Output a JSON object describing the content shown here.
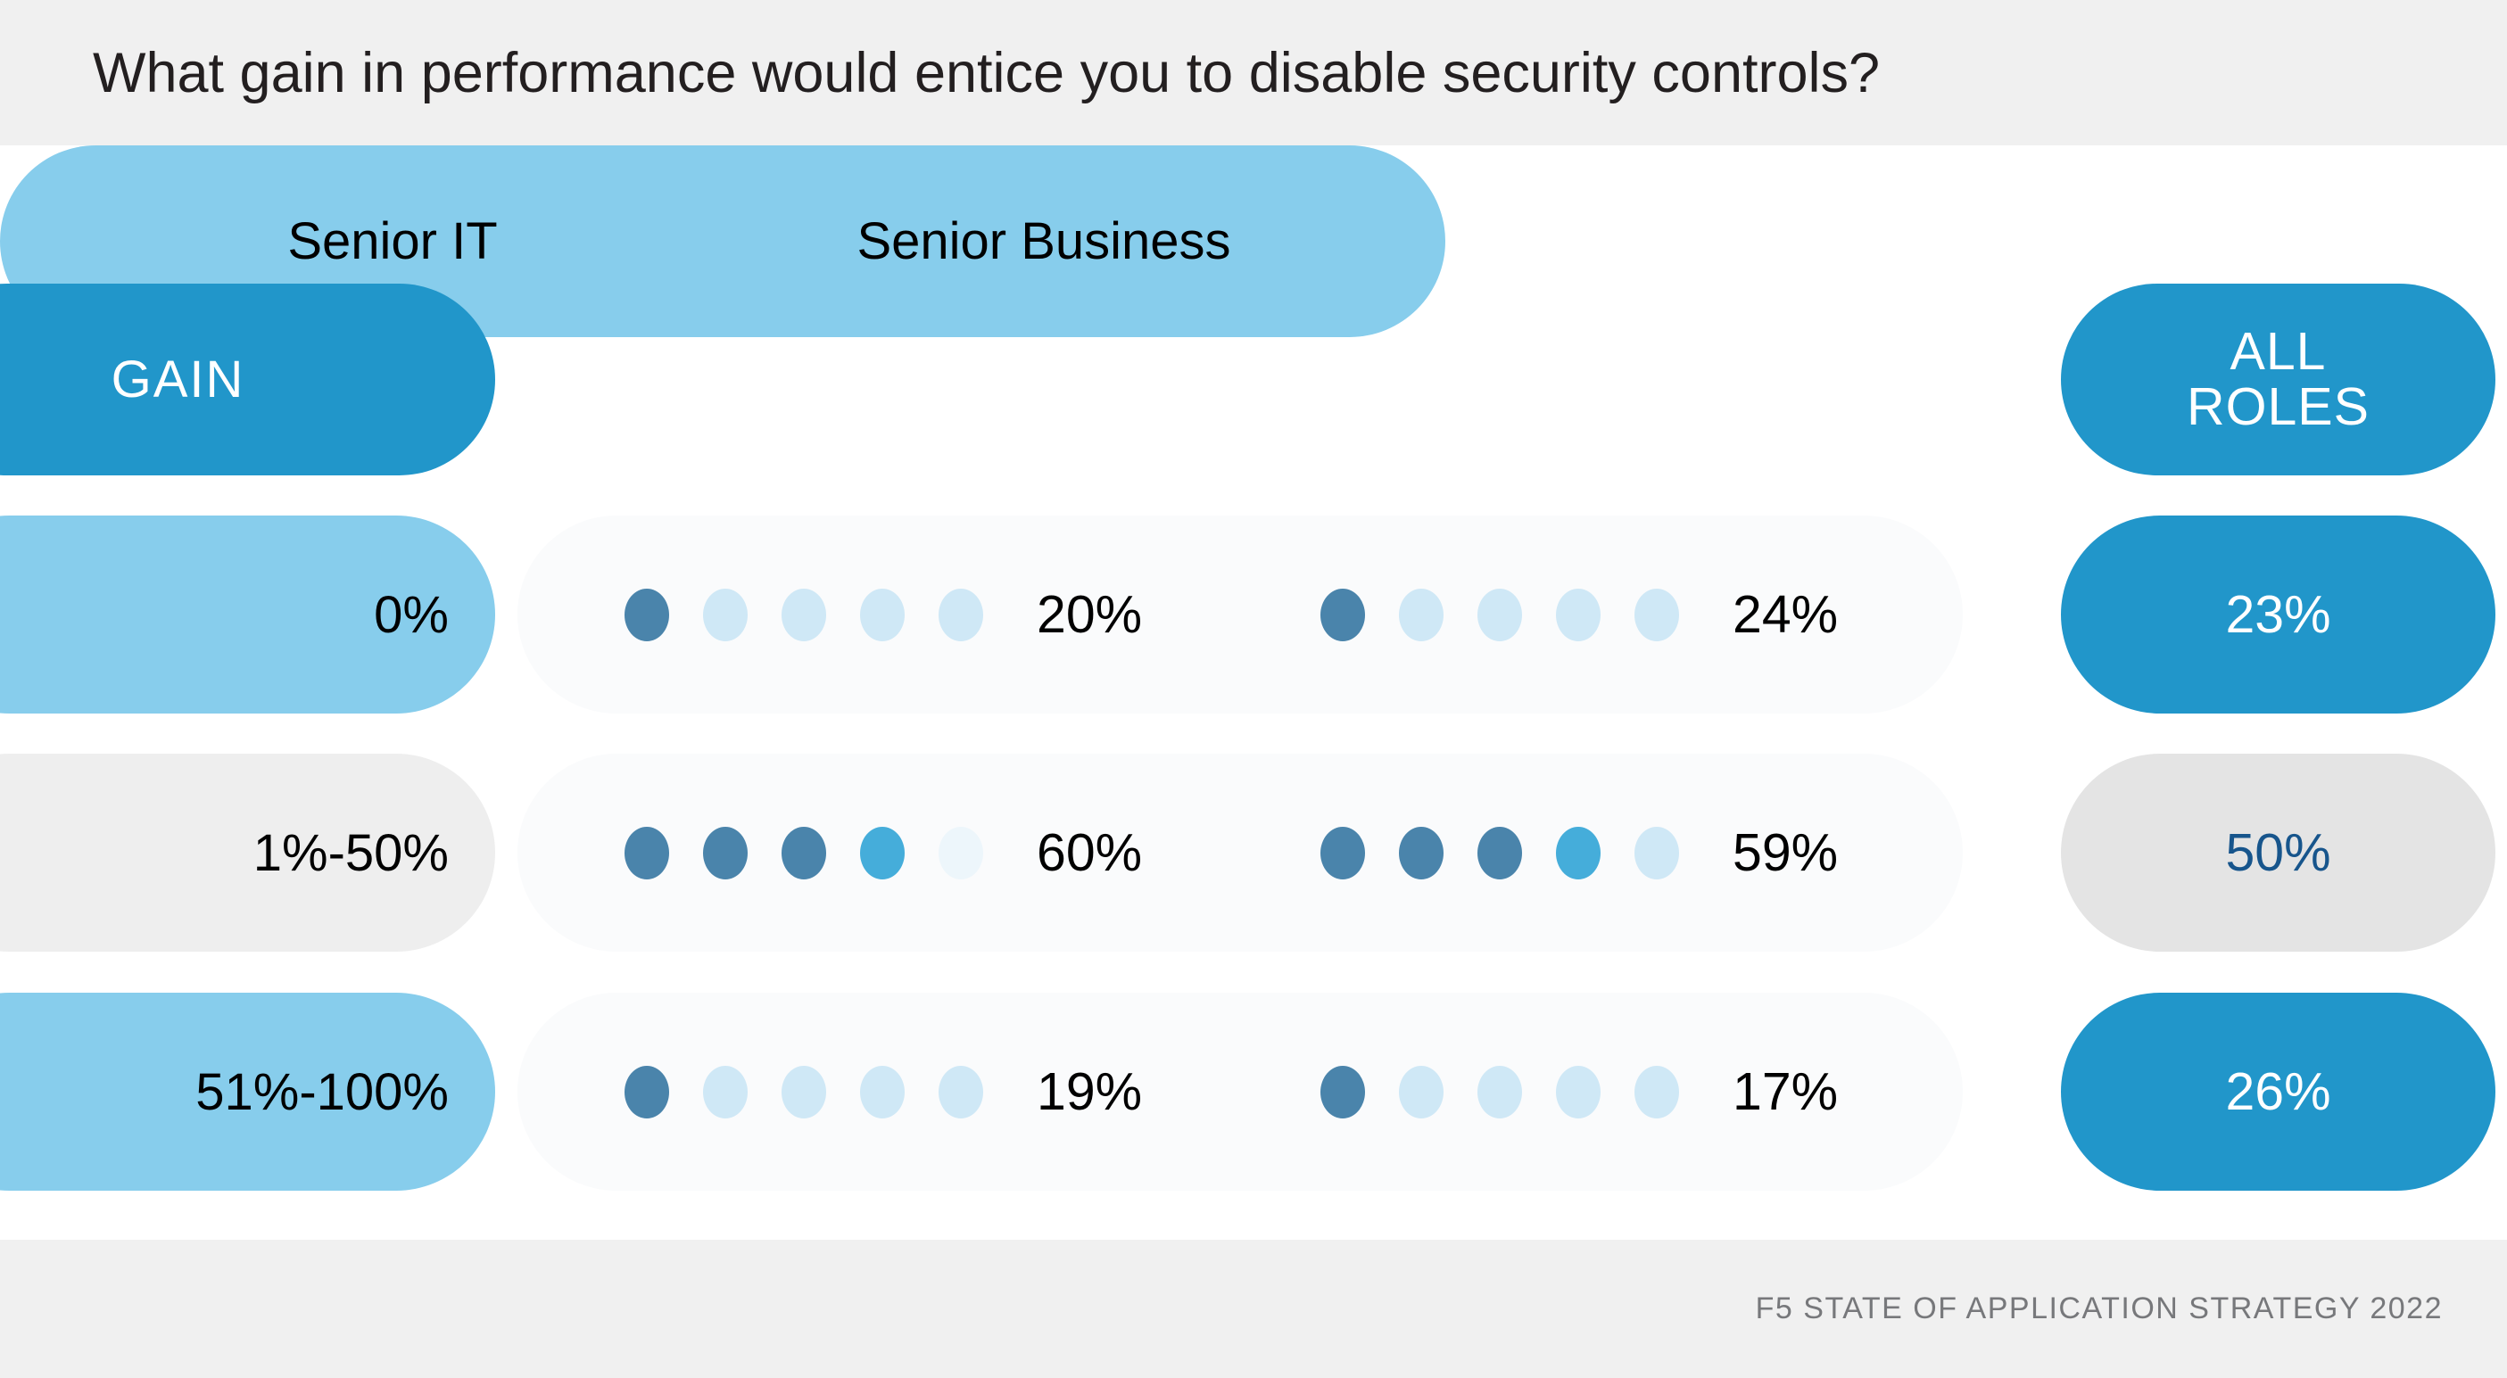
{
  "title": "What gain in performance would entice you to disable security controls?",
  "footer": "F5 STATE OF APPLICATION STRATEGY 2022",
  "header": {
    "gain_label": "GAIN",
    "col_senior_it": "Senior IT",
    "col_senior_business": "Senior Business",
    "all_roles_line1": "ALL",
    "all_roles_line2": "ROLES"
  },
  "rows": [
    {
      "category": "0%",
      "senior_it": "20%",
      "senior_business": "24%",
      "all_roles": "23%"
    },
    {
      "category": "1%-50%",
      "senior_it": "60%",
      "senior_business": "59%",
      "all_roles": "50%"
    },
    {
      "category": "51%-100%",
      "senior_it": "19%",
      "senior_business": "17%",
      "all_roles": "26%"
    }
  ],
  "colors": {
    "accent_blue": "#2196ca",
    "light_blue": "#87cdec",
    "dot_full": "#4a84ab",
    "dot_partial": "#45adda",
    "dot_empty": "#cfe8f6",
    "neutral_gray": "#eeeeee",
    "value_navy": "#17558c",
    "band_gray": "#f0f0f0",
    "footer_gray": "#77787b"
  },
  "chart_data": {
    "type": "table",
    "title": "What gain in performance would entice you to disable security controls?",
    "subtitle": "",
    "xlabel": "",
    "ylabel": "",
    "unit": "percent",
    "dot_scale": {
      "dots_per_group": 5,
      "percent_per_dot": 20
    },
    "categories": [
      "0%",
      "1%-50%",
      "51%-100%"
    ],
    "series": [
      {
        "name": "Senior IT",
        "values": [
          20,
          60,
          19
        ]
      },
      {
        "name": "Senior Business",
        "values": [
          24,
          59,
          17
        ]
      },
      {
        "name": "ALL ROLES",
        "values": [
          23,
          50,
          26
        ]
      }
    ],
    "dot_fills": {
      "Senior IT": [
        [
          "full",
          "empty",
          "empty",
          "empty",
          "empty"
        ],
        [
          "full",
          "full",
          "full",
          "partial",
          "faint"
        ],
        [
          "full",
          "empty",
          "empty",
          "empty",
          "empty"
        ]
      ],
      "Senior Business": [
        [
          "full",
          "empty",
          "empty",
          "empty",
          "empty"
        ],
        [
          "full",
          "full",
          "full",
          "partial",
          "empty"
        ],
        [
          "full",
          "empty",
          "empty",
          "empty",
          "empty"
        ]
      ]
    },
    "legend_position": "none",
    "grid": false
  }
}
